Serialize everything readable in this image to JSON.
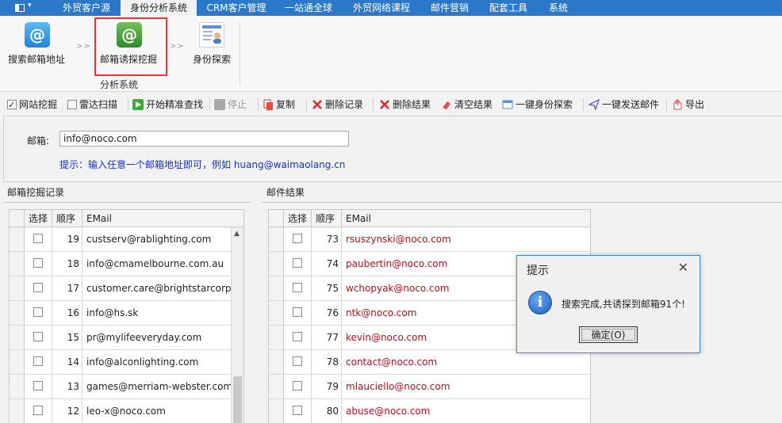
{
  "menubar": {
    "items": [
      "外贸客户源",
      "身份分析系统",
      "CRM客户管理",
      "一站通全球",
      "外贸网络课程",
      "邮件营销",
      "配套工具",
      "系统"
    ]
  },
  "ribbon": {
    "search_email": "搜索邮箱地址",
    "email_mining": "邮箱诱探挖掘",
    "identity_explore": "身份探索",
    "group_label": "分析系统",
    "arrow": ">>"
  },
  "toolbar": {
    "site_mining": "网站挖掘",
    "radar_scan": "雷达扫描",
    "start_search": "开始精准查找",
    "stop": "停止",
    "copy": "复制",
    "delete_records": "删除记录",
    "delete_results": "删除结果",
    "clear_results": "清空结果",
    "one_click_identity": "一键身份探索",
    "one_click_send": "一键发送邮件",
    "export": "导出"
  },
  "form": {
    "email_label": "邮箱:",
    "email_value": "info@noco.com",
    "hint": "提示：输入任意一个邮箱地址即可，例如 huang@waimaolang.cn"
  },
  "left_section": {
    "title": "邮箱挖掘记录",
    "columns": [
      "选择",
      "顺序",
      "EMail"
    ],
    "rows": [
      {
        "order": "19",
        "email": "custserv@rablighting.com"
      },
      {
        "order": "18",
        "email": "info@cmamelbourne.com.au"
      },
      {
        "order": "17",
        "email": "customer.care@brightstarcorp.in"
      },
      {
        "order": "16",
        "email": "info@hs.sk"
      },
      {
        "order": "15",
        "email": "pr@mylifeeveryday.com"
      },
      {
        "order": "14",
        "email": "info@alconlighting.com"
      },
      {
        "order": "13",
        "email": "games@merriam-webster.com"
      },
      {
        "order": "12",
        "email": "leo-x@noco.com"
      }
    ]
  },
  "right_section": {
    "title": "邮件结果",
    "columns": [
      "选择",
      "顺序",
      "EMail"
    ],
    "rows": [
      {
        "order": "73",
        "email": "rsuszynski@noco.com"
      },
      {
        "order": "74",
        "email": "paubertin@noco.com"
      },
      {
        "order": "75",
        "email": "wchopyak@noco.com"
      },
      {
        "order": "76",
        "email": "ntk@noco.com"
      },
      {
        "order": "77",
        "email": "kevin@noco.com"
      },
      {
        "order": "78",
        "email": "contact@noco.com"
      },
      {
        "order": "79",
        "email": "mlauciello@noco.com"
      },
      {
        "order": "80",
        "email": "abuse@noco.com"
      }
    ]
  },
  "dialog": {
    "title": "提示",
    "message": "搜索完成,共诱探到邮箱91个!",
    "ok": "确定(O)",
    "close": "✕"
  },
  "colors": {
    "menubar": "#2b78c8",
    "result_text": "#b4101a",
    "hint_text": "#1530c8",
    "highlight_border": "#ee3333"
  },
  "icons": {
    "app_menu": "app-menu-icon",
    "search_email": "at-sign-blue-icon",
    "email_mining": "at-sign-green-icon",
    "identity": "id-card-icon",
    "info": "info-icon"
  }
}
